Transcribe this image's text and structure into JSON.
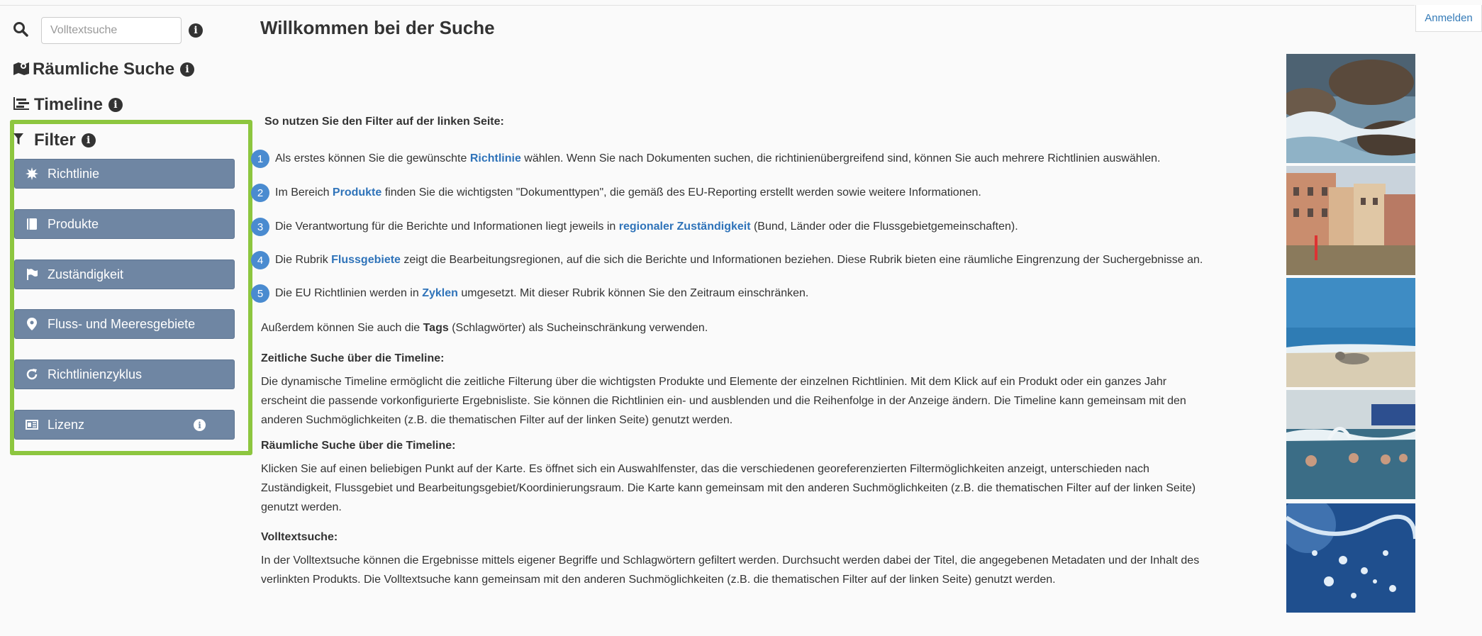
{
  "header": {
    "login_label": "Anmelden"
  },
  "sidebar": {
    "search_placeholder": "Volltextsuche",
    "spatial_label": "Räumliche Suche",
    "timeline_label": "Timeline",
    "filter_label": "Filter",
    "filters": [
      {
        "label": "Richtlinie",
        "icon": "gear-burst-icon"
      },
      {
        "label": "Produkte",
        "icon": "book-icon"
      },
      {
        "label": "Zuständigkeit",
        "icon": "flag-icon"
      },
      {
        "label": "Fluss- und Meeresgebiete",
        "icon": "map-marker-icon"
      },
      {
        "label": "Richtlinienzyklus",
        "icon": "refresh-icon"
      },
      {
        "label": "Lizenz",
        "icon": "license-icon"
      }
    ]
  },
  "main": {
    "title": "Willkommen bei der Suche",
    "intro": "So nutzen Sie den Filter auf der linken Seite:",
    "steps": [
      {
        "num": "1",
        "pre": "Als erstes können Sie die gewünschte ",
        "kw": "Richtlinie",
        "post": " wählen. Wenn Sie nach Dokumenten suchen, die richtinienübergreifend sind, können Sie auch mehrere Richtlinien auswählen."
      },
      {
        "num": "2",
        "pre": "Im Bereich ",
        "kw": "Produkte",
        "post": " finden Sie die wichtigsten \"Dokumenttypen\", die gemäß des EU-Reporting erstellt werden sowie weitere Informationen."
      },
      {
        "num": "3",
        "pre": "Die Verantwortung für die Berichte und Informationen liegt jeweils in ",
        "kw": "regionaler Zuständigkeit",
        "post": " (Bund, Länder oder die Flussgebietgemeinschaften)."
      },
      {
        "num": "4",
        "pre": "Die Rubrik ",
        "kw": "Flussgebiete",
        "post": " zeigt die Bearbeitungsregionen, auf die sich die Berichte und Informationen beziehen. Diese Rubrik bieten eine räumliche Eingrenzung der Suchergebnisse an."
      },
      {
        "num": "5",
        "pre": "Die EU Richtlinien werden in ",
        "kw": "Zyklen",
        "post": " umgesetzt. Mit dieser Rubrik können Sie den Zeitraum einschränken."
      }
    ],
    "tags_pre": "Außerdem können Sie auch die ",
    "tags_kw": "Tags",
    "tags_post": " (Schlagwörter) als Sucheinschränkung verwenden.",
    "sections": [
      {
        "heading": "Zeitliche Suche über die Timeline:",
        "lines": [
          "Die dynamische Timeline ermöglicht die zeitliche Filterung über die wichtigsten Produkte und Elemente der einzelnen Richtlinien. Mit dem Klick auf ein Produkt oder ein ganzes Jahr",
          "erscheint die passende vorkonfigurierte Ergebnisliste. Sie können die Richtlinien ein- und ausblenden und die Reihenfolge in der Anzeige ändern. Die Timeline kann gemeinsam mit den",
          "anderen Suchmöglichkeiten (z.B. die thematischen Filter auf der linken Seite) genutzt werden."
        ]
      },
      {
        "heading": "Räumliche Suche über die Timeline:",
        "lines": [
          "Klicken Sie auf einen beliebigen Punkt auf der Karte. Es öffnet sich ein Auswahlfenster, das die verschiedenen georeferenzierten Filtermöglichkeiten anzeigt, unterschieden nach",
          "Zuständigkeit, Flussgebiet und Bearbeitungsgebiet/Koordinierungsraum. Die Karte kann gemeinsam mit den anderen Suchmöglichkeiten (z.B. die thematischen Filter auf der linken Seite)",
          "genutzt werden."
        ]
      },
      {
        "heading": "Volltextsuche:",
        "lines": [
          "In der Volltextsuche können die Ergebnisse mittels eigener Begriffe und Schlagwörtern gefiltert werden. Durchsucht werden dabei der Titel, die angegebenen Metadaten und der Inhalt des",
          "verlinkten Produkts. Die Volltextsuche kann gemeinsam mit den anderen Suchmöglichkeiten (z.B. die thematischen Filter auf der linken Seite) genutzt werden."
        ]
      }
    ]
  },
  "colors": {
    "accent": "#2f73b9",
    "filter_button": "#6f86a3",
    "highlight_border": "#8dc63f",
    "step_badge": "#4a8bd0"
  }
}
